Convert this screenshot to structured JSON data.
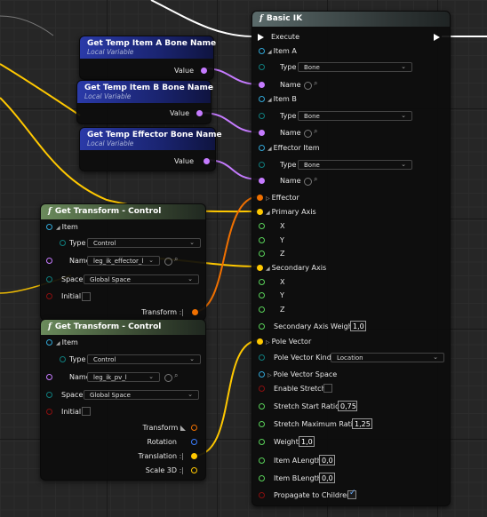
{
  "colors": {
    "exec": "#ffffff",
    "name": "#c57bff",
    "struct": "#f0a000",
    "float": "#59d159",
    "bool": "#8a0f0f",
    "enum": "#0f7d7d",
    "transform": "#f07000",
    "vector": "#ffc800",
    "rotator": "#3a7dff"
  },
  "var_a": {
    "title": "Get Temp Item A Bone Name",
    "subtitle": "Local Variable",
    "pin": "Value"
  },
  "var_b": {
    "title": "Get Temp Item B Bone Name",
    "subtitle": "Local Variable",
    "pin": "Value"
  },
  "var_eff": {
    "title": "Get Temp Effector Bone Name",
    "subtitle": "Local Variable",
    "pin": "Value"
  },
  "gt1": {
    "title": "Get Transform - Control",
    "item": "Item",
    "type_label": "Type",
    "type_value": "Control",
    "name_label": "Name",
    "name_value": "leg_ik_effector_l",
    "space_label": "Space",
    "space_value": "Global Space",
    "initial_label": "Initial",
    "transform_label": "Transform"
  },
  "gt2": {
    "title": "Get Transform - Control",
    "item": "Item",
    "type_label": "Type",
    "type_value": "Control",
    "name_label": "Name",
    "name_value": "leg_ik_pv_l",
    "space_label": "Space",
    "space_value": "Global Space",
    "initial_label": "Initial",
    "transform_label": "Transform",
    "rotation_label": "Rotation",
    "translation_label": "Translation",
    "scale_label": "Scale 3D"
  },
  "ik": {
    "title": "Basic IK",
    "execute": "Execute",
    "item_a": "Item A",
    "item_b": "Item B",
    "effector_item": "Effector Item",
    "type_label": "Type",
    "bone": "Bone",
    "name_label": "Name",
    "effector": "Effector",
    "primary_axis": "Primary Axis",
    "x": "X",
    "y": "Y",
    "z": "Z",
    "secondary_axis": "Secondary Axis",
    "secondary_axis_weight": "Secondary Axis Weight",
    "secondary_axis_weight_value": "1,0",
    "pole_vector": "Pole Vector",
    "pole_vector_kind": "Pole Vector Kind",
    "pole_vector_kind_value": "Location",
    "pole_vector_space": "Pole Vector Space",
    "enable_stretch": "Enable Stretch",
    "stretch_start_ratio": "Stretch Start Ratio",
    "stretch_start_ratio_value": "0,75",
    "stretch_max_ratio": "Stretch Maximum Ratio",
    "stretch_max_ratio_value": "1,25",
    "weight": "Weight",
    "weight_value": "1,0",
    "item_a_length": "Item ALength",
    "item_a_length_value": "0,0",
    "item_b_length": "Item BLength",
    "item_b_length_value": "0,0",
    "propagate": "Propagate to Children",
    "propagate_checked": true
  }
}
